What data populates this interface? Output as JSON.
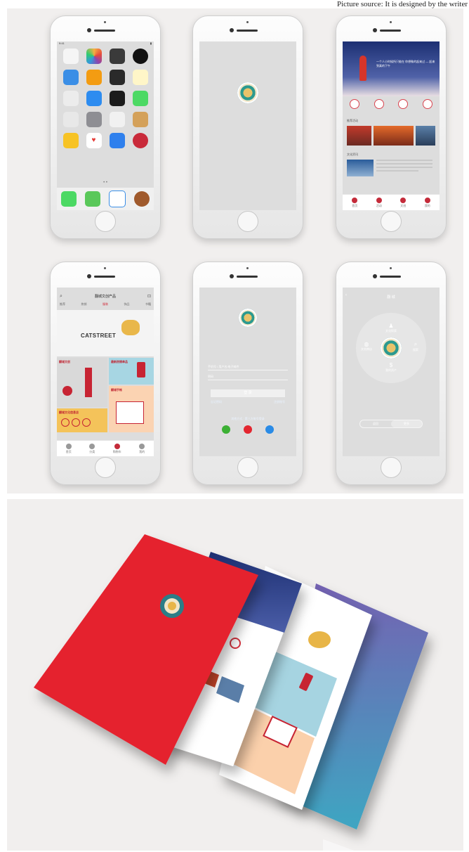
{
  "caption": "Picture source: It is designed by the writer",
  "phones": {
    "home": {
      "status_time": "9:41",
      "page_dots": "• •"
    },
    "news": {
      "banner_text": "一个人小时候所只能在 你想象的起来过 — 起来到真的下午",
      "section_1": "推荐活动",
      "section_2": "文化资讯",
      "tabs": [
        "首页",
        "活动",
        "文创",
        "我的"
      ]
    },
    "shop": {
      "title": "翻城文创产品",
      "tabs": [
        "推荐",
        "热销",
        "服装",
        "饰品",
        "书籍"
      ],
      "hero_word": "CATSTREET",
      "block_1": "翻城文创",
      "block_2": "最新热销单品",
      "block_3": "翻城手帐",
      "block_4": "翻城文化信息店",
      "nav": [
        "首页",
        "分类",
        "购物车",
        "我的"
      ]
    },
    "login": {
      "user_placeholder": "手机号 / 用户名/电子邮件",
      "pass_placeholder": "密码",
      "login_button": "登 录",
      "forgot": "忘记密码",
      "register": "注册账号",
      "third_party": "其他方式 · 第三方账号登录"
    },
    "menu": {
      "title": "翻 城",
      "items": [
        "文化探索",
        "文创商店",
        "搜索",
        "我的资产"
      ],
      "toggle": [
        "返回",
        "更多"
      ]
    }
  },
  "colors": {
    "splash_red": "#e5212f",
    "login_top": "#6c61b0",
    "login_bottom": "#3fb1c7",
    "banner_navy": "#1c2f73"
  }
}
